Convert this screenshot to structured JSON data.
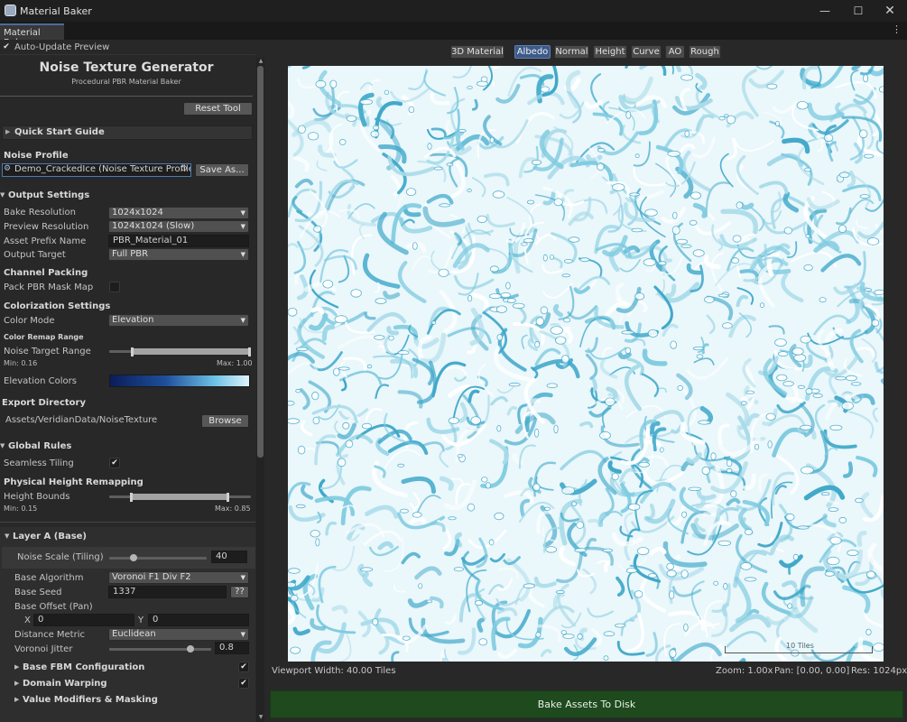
{
  "window": {
    "title": "Material Baker",
    "minimize": "—",
    "maximize": "☐",
    "close": "✕"
  },
  "tab": {
    "label": "Material Baker",
    "more": "⋮"
  },
  "auto_update": {
    "label": "Auto-Update Preview",
    "checked": true
  },
  "header": {
    "title": "Noise Texture Generator",
    "subtitle": "Procedural PBR Material Baker",
    "reset": "Reset Tool"
  },
  "quick_start": "Quick Start Guide",
  "noise_profile": {
    "label": "Noise Profile",
    "value": "Demo_CrackedIce (Noise Texture Profile)",
    "save": "Save As..."
  },
  "output": {
    "header": "Output Settings",
    "bake_resolution": {
      "label": "Bake Resolution",
      "value": "1024x1024"
    },
    "preview_resolution": {
      "label": "Preview Resolution",
      "value": "1024x1024 (Slow)"
    },
    "asset_prefix": {
      "label": "Asset Prefix Name",
      "value": "PBR_Material_01"
    },
    "output_target": {
      "label": "Output Target",
      "value": "Full PBR"
    }
  },
  "channel_packing": {
    "header": "Channel Packing",
    "pack_label": "Pack PBR Mask Map",
    "checked": false
  },
  "colorization": {
    "header": "Colorization Settings",
    "color_mode": {
      "label": "Color Mode",
      "value": "Elevation"
    },
    "remap_header": "Color Remap Range",
    "target_range": {
      "label": "Noise Target Range",
      "min": "Min: 0.16",
      "max": "Max: 1.00",
      "min_value": 0.16,
      "max_value": 1.0
    },
    "elevation_label": "Elevation Colors"
  },
  "export": {
    "header": "Export Directory",
    "path": "Assets/VeridianData/NoiseTexture",
    "browse": "Browse"
  },
  "global_rules": {
    "header": "Global Rules",
    "seamless_label": "Seamless Tiling",
    "seamless_checked": true
  },
  "height_remap": {
    "header": "Physical Height Remapping",
    "label": "Height Bounds",
    "min": "Min: 0.15",
    "max": "Max: 0.85",
    "min_value": 0.15,
    "max_value": 0.85
  },
  "layer_a": {
    "header": "Layer A (Base)",
    "noise_scale": {
      "label": "Noise Scale (Tiling)",
      "value": "40",
      "fraction": 0.25
    },
    "base_algorithm": {
      "label": "Base Algorithm",
      "value": "Voronoi F1 Div F2"
    },
    "base_seed": {
      "label": "Base Seed",
      "value": "1337",
      "random": "??"
    },
    "base_offset": {
      "label": "Base Offset (Pan)",
      "x_label": "X",
      "x": "0",
      "y_label": "Y",
      "y": "0"
    },
    "distance_metric": {
      "label": "Distance Metric",
      "value": "Euclidean"
    },
    "voronoi_jitter": {
      "label": "Voronoi Jitter",
      "value": "0.8",
      "fraction": 0.8
    },
    "fbm": {
      "label": "Base FBM Configuration",
      "checked": true
    },
    "warping": {
      "label": "Domain Warping",
      "checked": true
    },
    "modifiers": "Value Modifiers & Masking"
  },
  "channels": [
    "3D Material",
    "Albedo",
    "Normal",
    "Height",
    "Curve",
    "AO",
    "Rough"
  ],
  "active_channel": "Albedo",
  "viewport": {
    "width_label": "Viewport Width: 40.00 Tiles",
    "zoom": "Zoom: 1.00x",
    "pan": "Pan: [0.00, 0.00]",
    "res": "Res: 1024px",
    "scale_label": "10 Tiles"
  },
  "bake_button": "Bake Assets To Disk",
  "colors": {
    "bake": "#1e4a1e",
    "active_tab": "#3e5a86",
    "ice_light": "#eaf7fb",
    "ice_mid": "#7fcbe0",
    "ice_dark": "#3ea7c9"
  }
}
